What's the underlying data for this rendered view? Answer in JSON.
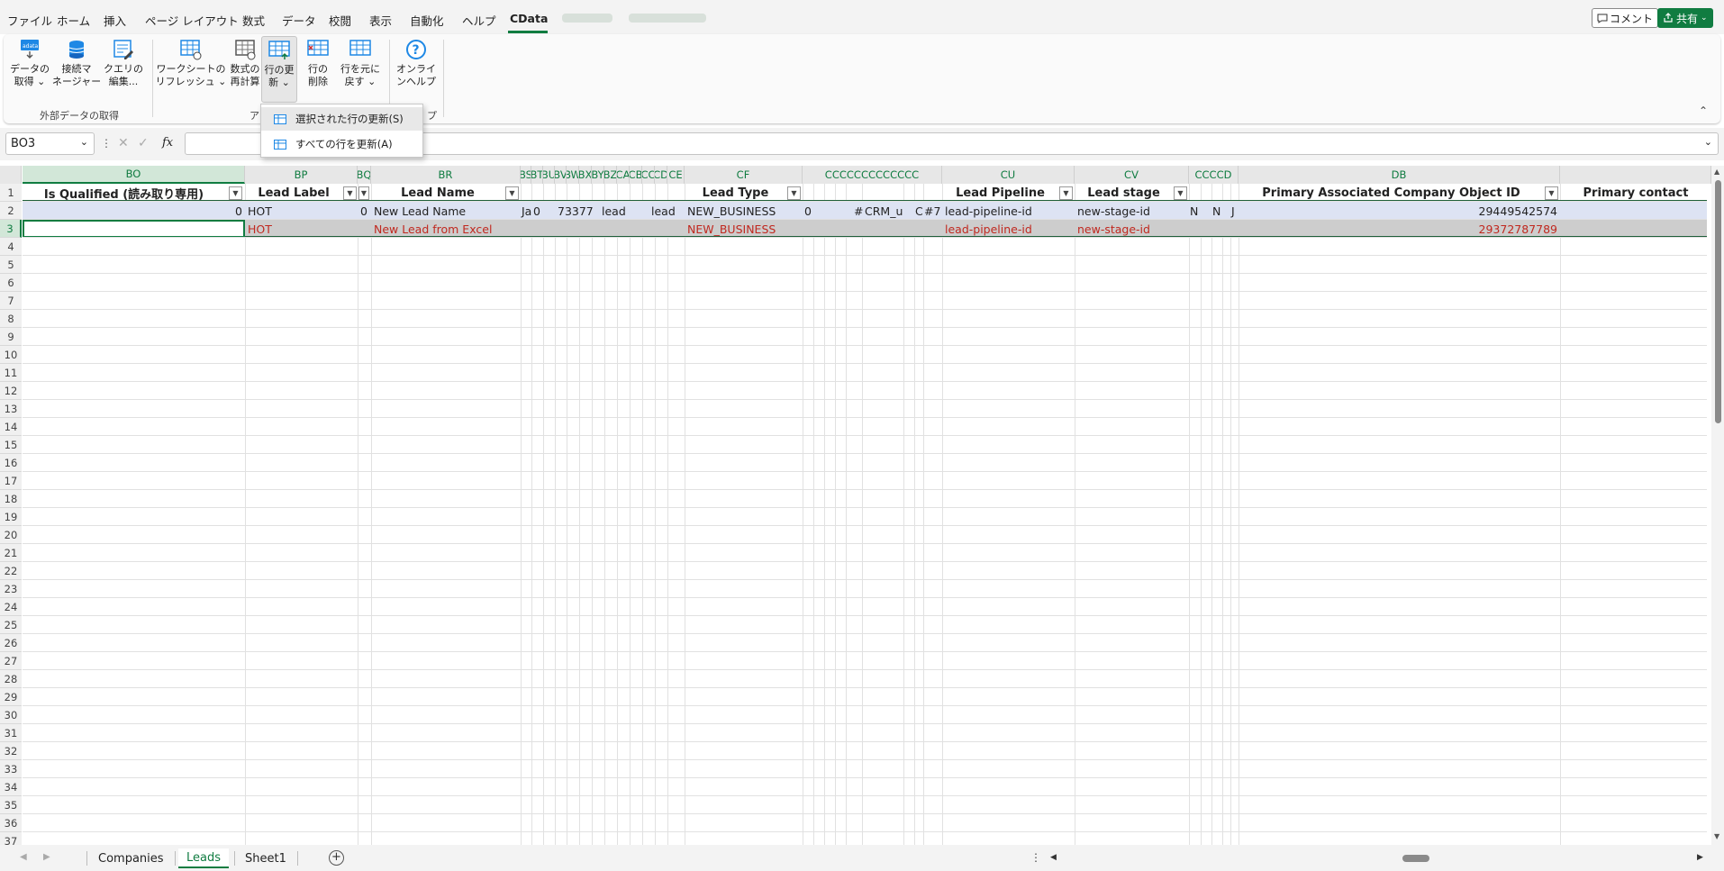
{
  "menu": {
    "items": [
      "ファイル",
      "ホーム",
      "挿入",
      "ページ レイアウト",
      "数式",
      "データ",
      "校閲",
      "表示",
      "自動化",
      "ヘルプ",
      "CData"
    ],
    "active": "CData",
    "comment_label": "コメント",
    "share_label": "共有"
  },
  "ribbon": {
    "buttons": {
      "get_data": "データの\n取得 ⌄",
      "connection_manager": "接続マ\nネージャー",
      "query_edit": "クエリの\n編集...",
      "refresh_sheet": "ワークシートの\nリフレッシュ ⌄",
      "recalc": "数式の\n再計算",
      "update_rows": "行の更\n新 ⌄",
      "delete_rows": "行の\n削除",
      "revert_rows": "行を元に\n戻す ⌄",
      "online_help": "オンライ\nンヘルプ"
    },
    "groups": {
      "external": "外部データの取得",
      "action": "ア",
      "help": "プ"
    }
  },
  "dropdown": {
    "items": [
      "選択された行の更新(S)",
      "すべての行を更新(A)"
    ]
  },
  "formula_bar": {
    "name_box": "BO3",
    "fx": "fx",
    "value": ""
  },
  "grid": {
    "headers": {
      "BO": "Is Qualified (読み取り専用)",
      "BP": "Lead Label",
      "BR": "Lead Name",
      "CF": "Lead Type",
      "CU": "Lead Pipeline",
      "CV": "Lead stage",
      "DB": "Primary Associated Company Object ID",
      "DC": "Primary contact"
    },
    "row2": {
      "BO": "0",
      "BP": "HOT",
      "BQ": "0",
      "BR": "New Lead Name",
      "BS": "Ja",
      "BT": "0",
      "BW": "73377",
      "BZ": "lead",
      "CC": "lead",
      "CF": "NEW_BUSINESS",
      "CG": "0",
      "CL": "#",
      "CM": "CRM_u",
      "CP": "C",
      "CQ": "#7",
      "CU": "lead-pipeline-id",
      "CV": "new-stage-id",
      "CW": "N",
      "CY": "N",
      "DA": "J",
      "DB": "29449542574"
    },
    "row3": {
      "BP": "HOT",
      "BR": "New Lead from Excel",
      "CF": "NEW_BUSINESS",
      "CU": "lead-pipeline-id",
      "CV": "new-stage-id",
      "DB": "29372787789"
    },
    "row_numbers": [
      "1",
      "2",
      "3",
      "4",
      "5",
      "6",
      "7",
      "8",
      "9",
      "10",
      "11",
      "12",
      "13",
      "14",
      "15",
      "16",
      "17",
      "18",
      "19",
      "20",
      "21",
      "22",
      "23",
      "24",
      "25",
      "26",
      "27",
      "28",
      "29",
      "30",
      "31",
      "32",
      "33",
      "34",
      "35",
      "36",
      "37"
    ]
  },
  "sheets": {
    "tabs": [
      "Companies",
      "Leads",
      "Sheet1"
    ],
    "active": "Leads"
  },
  "colors": {
    "accent": "#107c41",
    "row3_text": "#c0281f",
    "row2_fill": "#dde3f3",
    "row3_fill": "#cdcdcd"
  }
}
